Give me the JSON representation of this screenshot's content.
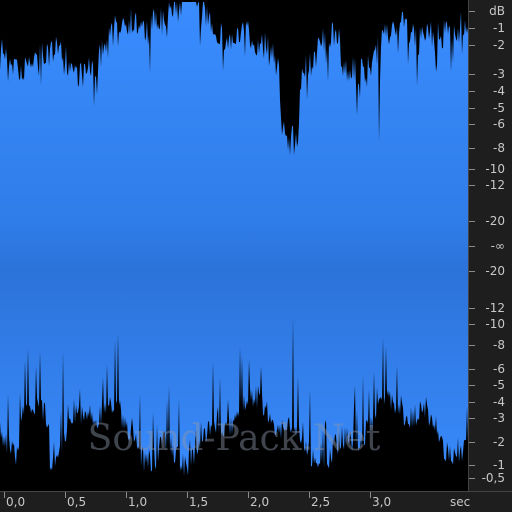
{
  "app": {
    "unit_db": "dB",
    "unit_time": "sec",
    "watermark": "Sound-Pack.Net"
  },
  "colors": {
    "background": "#1e1e1e",
    "waveform_fill": "#3a8cff",
    "waveform_envelope": "#000000",
    "ruler_text": "#c8c8c8"
  },
  "db_scale": [
    "dB",
    "-1",
    "-2",
    "-3",
    "-4",
    "-5",
    "-6",
    "-8",
    "-10",
    "-12",
    "-20",
    "-∞",
    "-20",
    "-12",
    "-10",
    "-8",
    "-6",
    "-5",
    "-4",
    "-3",
    "-2",
    "-1",
    "-0,5"
  ],
  "time_scale": [
    "0,0",
    "0,5",
    "1,0",
    "1,5",
    "2,0",
    "2,5",
    "3,0",
    "sec"
  ]
}
